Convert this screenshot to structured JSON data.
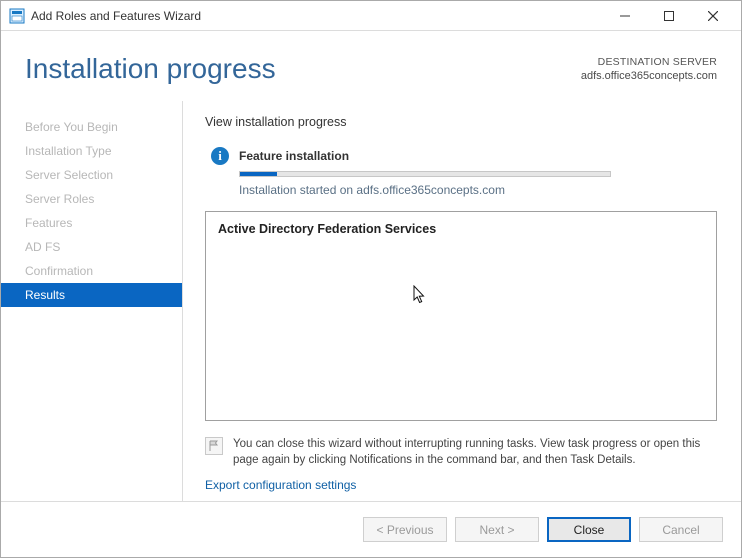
{
  "window": {
    "title": "Add Roles and Features Wizard"
  },
  "header": {
    "page_title": "Installation progress",
    "destination_label": "DESTINATION SERVER",
    "destination_server": "adfs.office365concepts.com"
  },
  "sidebar": {
    "items": [
      {
        "label": "Before You Begin",
        "active": false
      },
      {
        "label": "Installation Type",
        "active": false
      },
      {
        "label": "Server Selection",
        "active": false
      },
      {
        "label": "Server Roles",
        "active": false
      },
      {
        "label": "Features",
        "active": false
      },
      {
        "label": "AD FS",
        "active": false
      },
      {
        "label": "Confirmation",
        "active": false
      },
      {
        "label": "Results",
        "active": true
      }
    ]
  },
  "main": {
    "view_title": "View installation progress",
    "feature_title": "Feature installation",
    "install_started_text": "Installation started on adfs.office365concepts.com",
    "progress_percent": 10,
    "result_heading": "Active Directory Federation Services",
    "note_text": "You can close this wizard without interrupting running tasks. View task progress or open this page again by clicking Notifications in the command bar, and then Task Details.",
    "export_link": "Export configuration settings"
  },
  "footer": {
    "previous": "< Previous",
    "next": "Next >",
    "close": "Close",
    "cancel": "Cancel"
  },
  "colors": {
    "accent": "#0a66c2",
    "heading": "#336699"
  }
}
